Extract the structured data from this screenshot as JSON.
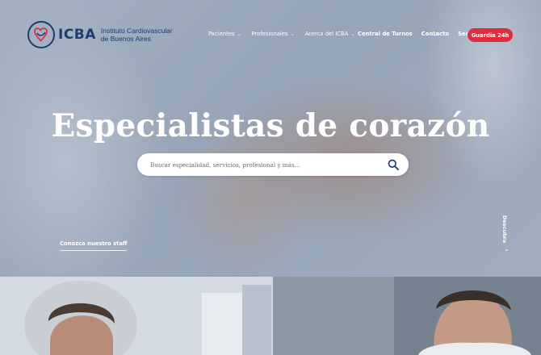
{
  "brand": {
    "name": "ICBA",
    "subtitle_line1": "Instituto Cardiovascular",
    "subtitle_line2": "de Buenos Aires",
    "color": "#1e3c6e"
  },
  "nav": {
    "dropdowns": [
      {
        "label": "Pacientes",
        "icon": "chevron-down-icon"
      },
      {
        "label": "Profesionales",
        "icon": "chevron-down-icon"
      },
      {
        "label": "Acerca del ICBA",
        "icon": "chevron-down-icon"
      }
    ],
    "links": [
      "Central de Turnos",
      "Contacto",
      "Sedes"
    ],
    "cta_label": "Guardia 24h",
    "cta_color": "#e02c3b"
  },
  "hero": {
    "headline": "Especialistas de corazón",
    "search_placeholder": "Buscar especialidad, servicios, profesional y más...",
    "search_icon": "search-icon",
    "staff_link": "Conozca nuestro staff",
    "scroll_label": "Descubra",
    "scroll_icon": "chevron-down-icon"
  }
}
